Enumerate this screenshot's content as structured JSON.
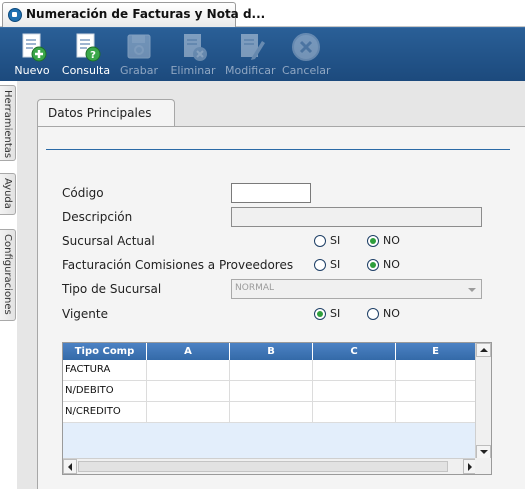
{
  "window_tab": {
    "title": "Numeración de Facturas y Nota d..."
  },
  "toolbar": {
    "buttons": [
      {
        "label": "Nuevo",
        "icon": "new-document-icon",
        "enabled": true
      },
      {
        "label": "Consulta",
        "icon": "query-document-icon",
        "enabled": true
      },
      {
        "label": "Grabar",
        "icon": "save-disk-icon",
        "enabled": false
      },
      {
        "label": "Eliminar",
        "icon": "delete-document-icon",
        "enabled": false
      },
      {
        "label": "Modificar",
        "icon": "edit-document-icon",
        "enabled": false
      },
      {
        "label": "Cancelar",
        "icon": "cancel-circle-icon",
        "enabled": false
      }
    ]
  },
  "side_tabs": [
    "Herramientas",
    "Ayuda",
    "Configuraciones"
  ],
  "form": {
    "tab_label": "Datos Principales",
    "codigo": {
      "label": "Código",
      "value": ""
    },
    "descripcion": {
      "label": "Descripción",
      "value": ""
    },
    "sucursal_actual": {
      "label": "Sucursal Actual",
      "si": "SI",
      "no": "NO",
      "selected": "NO"
    },
    "facturacion_comisiones": {
      "label": "Facturación Comisiones a Proveedores",
      "si": "SI",
      "no": "NO",
      "selected": "NO"
    },
    "tipo_sucursal": {
      "label": "Tipo de Sucursal",
      "value": "NORMAL"
    },
    "vigente": {
      "label": "Vigente",
      "si": "SI",
      "no": "NO",
      "selected": "SI"
    }
  },
  "grid": {
    "columns": [
      "Tipo Comp",
      "A",
      "B",
      "C",
      "E"
    ],
    "rows": [
      [
        "FACTURA",
        "",
        "",
        "",
        ""
      ],
      [
        "N/DEBITO",
        "",
        "",
        "",
        ""
      ],
      [
        "N/CREDITO",
        "",
        "",
        "",
        ""
      ]
    ]
  },
  "colors": {
    "toolbar_bg": "#1c4a7d",
    "grid_header": "#3a70b0",
    "radio_selected": "#2e9e3c",
    "accent_line": "#2b6aa6"
  }
}
